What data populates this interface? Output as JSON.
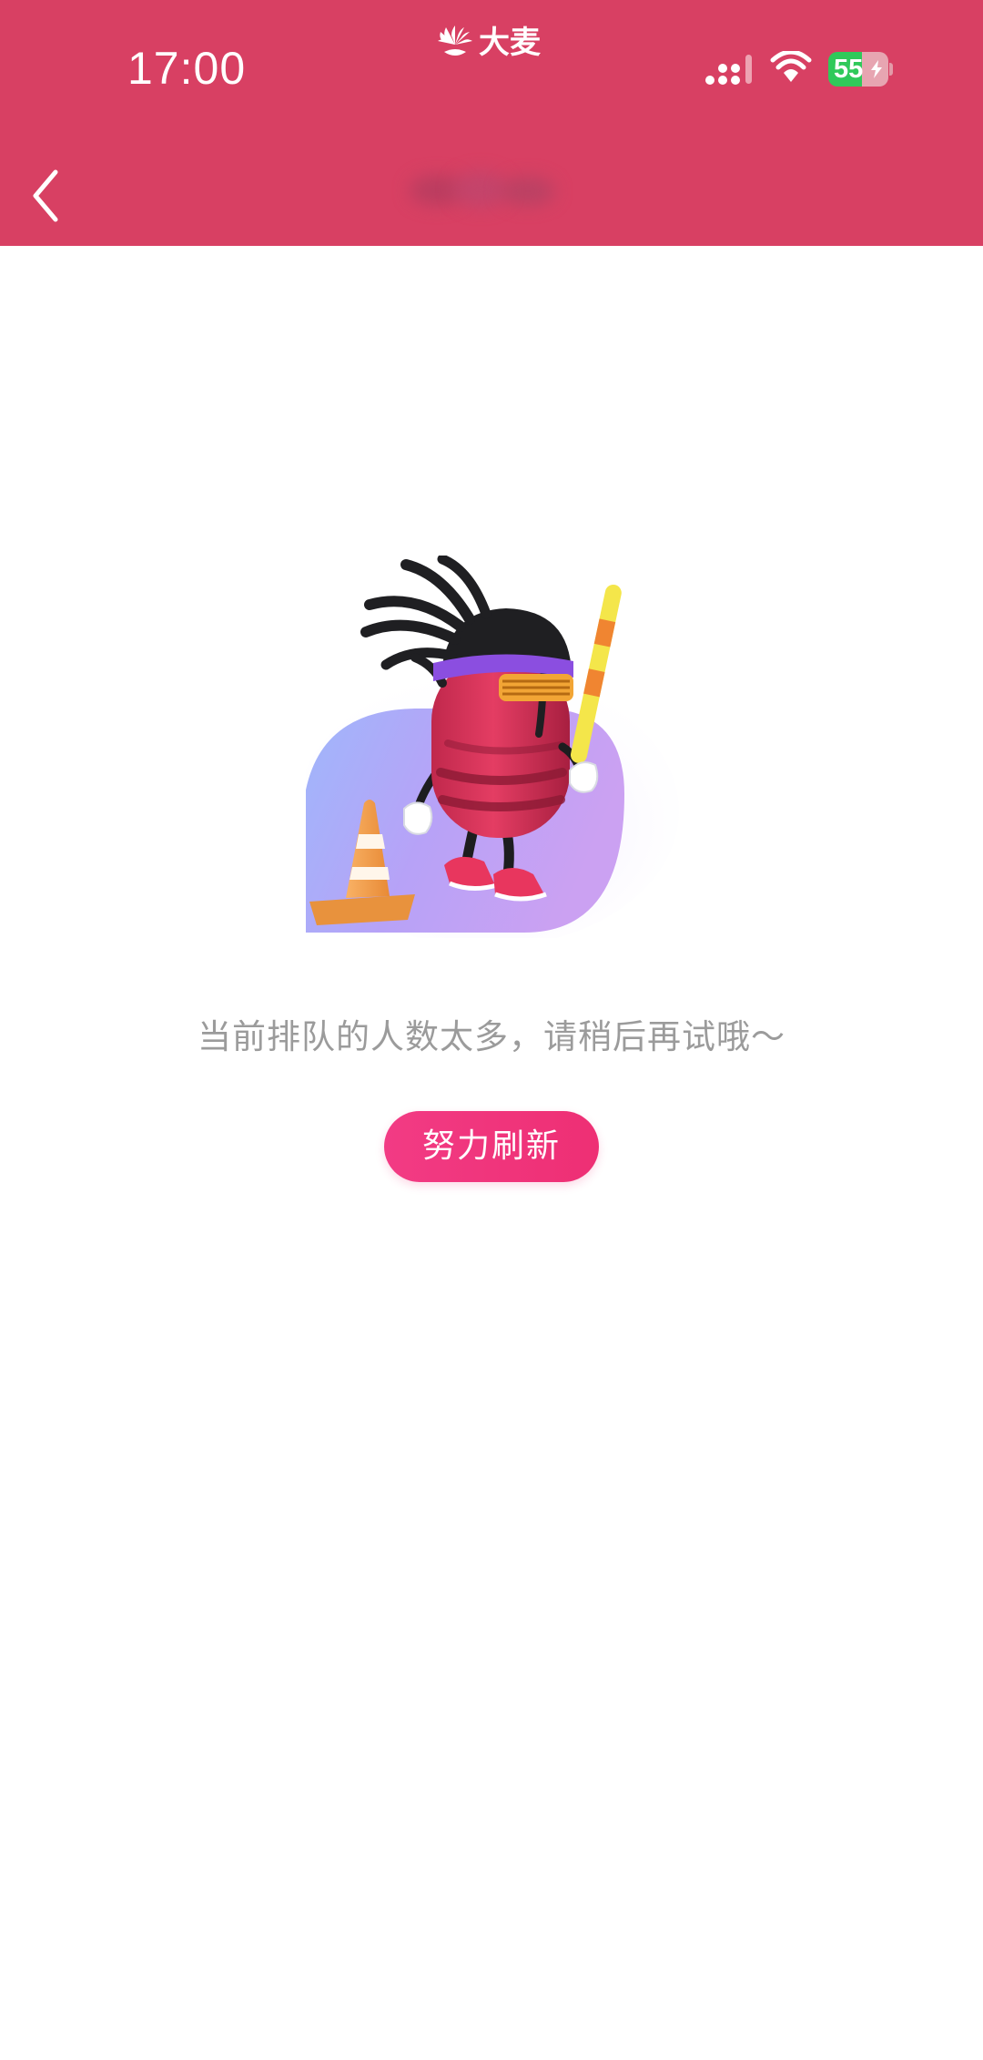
{
  "status_bar": {
    "time": "17:00",
    "logo_text": "大麦",
    "battery_level": "55"
  },
  "colors": {
    "header_bg": "#d84063",
    "button_bg": "#ee2f74",
    "message_text": "#9b9b9b",
    "battery_green": "#30c95a"
  },
  "icons": {
    "back": "chevron-left-icon",
    "signal": "signal-icon",
    "wifi": "wifi-icon",
    "battery": "battery-charging-icon",
    "logo": "damai-logo-icon"
  },
  "content": {
    "message": "当前排队的人数太多，请稍后再试哦～",
    "refresh_button_label": "努力刷新"
  }
}
